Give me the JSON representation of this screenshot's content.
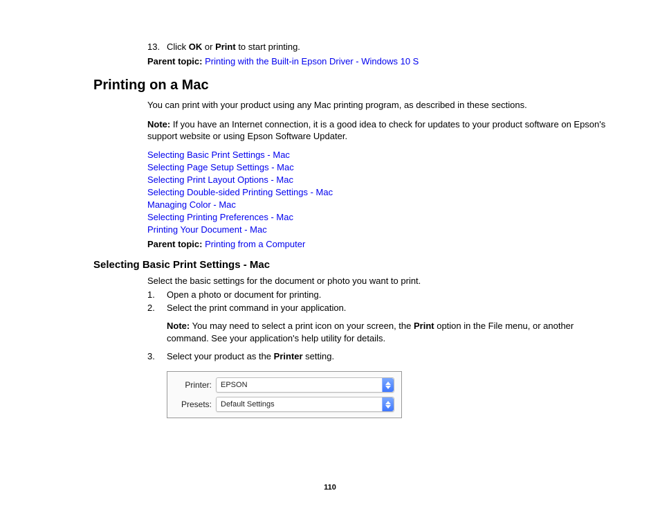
{
  "item13": {
    "num": "13.",
    "pre": "Click ",
    "b1": "OK",
    "mid": " or ",
    "b2": "Print",
    "post": " to start printing."
  },
  "parent1": {
    "label": "Parent topic:",
    "link": "Printing with the Built-in Epson Driver - Windows 10 S"
  },
  "h1": "Printing on a Mac",
  "intro": "You can print with your product using any Mac printing program, as described in these sections.",
  "note1": {
    "label": "Note:",
    "text": " If you have an Internet connection, it is a good idea to check for updates to your product software on Epson's support website or using Epson Software Updater."
  },
  "links": [
    "Selecting Basic Print Settings - Mac",
    "Selecting Page Setup Settings - Mac",
    "Selecting Print Layout Options - Mac",
    "Selecting Double-sided Printing Settings - Mac",
    "Managing Color - Mac",
    "Selecting Printing Preferences - Mac",
    "Printing Your Document - Mac"
  ],
  "parent2": {
    "label": "Parent topic:",
    "link": "Printing from a Computer"
  },
  "h2": "Selecting Basic Print Settings - Mac",
  "sub_intro": "Select the basic settings for the document or photo you want to print.",
  "steps": {
    "s1": {
      "num": "1.",
      "text": "Open a photo or document for printing."
    },
    "s2": {
      "num": "2.",
      "text": "Select the print command in your application."
    },
    "s3": {
      "num": "3.",
      "pre": "Select your product as the ",
      "b": "Printer",
      "post": " setting."
    }
  },
  "note2": {
    "label": "Note:",
    "pre": " You may need to select a print icon on your screen, the ",
    "b": "Print",
    "post": " option in the File menu, or another command. See your application's help utility for details."
  },
  "panel": {
    "printer_label": "Printer:",
    "printer_value": "EPSON",
    "presets_label": "Presets:",
    "presets_value": "Default Settings"
  },
  "page_number": "110"
}
